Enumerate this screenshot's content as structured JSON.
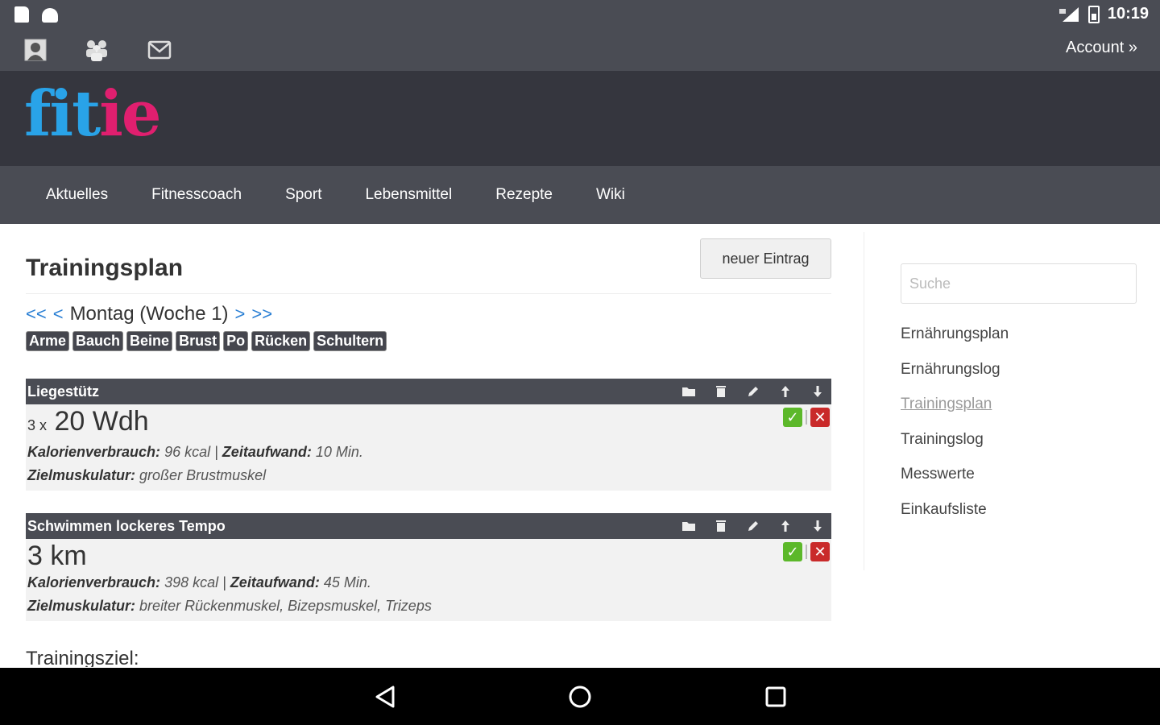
{
  "status_bar": {
    "time": "10:19"
  },
  "top_bar": {
    "account_label": "Account »"
  },
  "logo": {
    "part1": "fit",
    "part2": "ie",
    "accent_blue": "#29a3e8",
    "accent_pink": "#e01f6f"
  },
  "nav": [
    "Aktuelles",
    "Fitnesscoach",
    "Sport",
    "Lebensmittel",
    "Rezepte",
    "Wiki"
  ],
  "main": {
    "title": "Trainingsplan",
    "new_entry_label": "neuer Eintrag",
    "day_nav": {
      "first": "<<",
      "prev": "<",
      "label": "Montag (Woche 1)",
      "next": ">",
      "last": ">>"
    },
    "tags": [
      "Arme",
      "Bauch",
      "Beine",
      "Brust",
      "Po",
      "Rücken",
      "Schultern"
    ],
    "exercises": [
      {
        "name": "Liegestütz",
        "sets": "3 x",
        "amount": "20 Wdh",
        "calories_label": "Kalorienverbrauch:",
        "calories": "96 kcal",
        "time_label": "Zeitaufwand:",
        "time": "10 Min.",
        "muscles_label": "Zielmuskulatur:",
        "muscles": "großer Brustmuskel"
      },
      {
        "name": "Schwimmen lockeres Tempo",
        "sets": "",
        "amount": "3 km",
        "calories_label": "Kalorienverbrauch:",
        "calories": "398 kcal",
        "time_label": "Zeitaufwand:",
        "time": "45 Min.",
        "muscles_label": "Zielmuskulatur:",
        "muscles": "breiter Rückenmuskel, Bizepsmuskel, Trizeps"
      }
    ],
    "goal_label": "Trainingsziel:"
  },
  "sidebar": {
    "search_placeholder": "Suche",
    "links": [
      "Ernährungsplan",
      "Ernährungslog",
      "Trainingsplan",
      "Trainingslog",
      "Messwerte",
      "Einkaufsliste"
    ],
    "active_index": 2
  }
}
